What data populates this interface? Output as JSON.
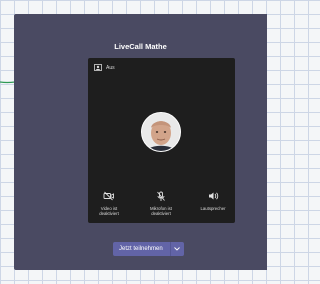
{
  "meeting": {
    "title": "LiveCall Mathe"
  },
  "preview": {
    "background_label": "Aus"
  },
  "controls": {
    "video": {
      "line1": "Video ist",
      "line2": "deaktiviert",
      "icon": "video-off-icon"
    },
    "mic": {
      "line1": "Mikrofon ist",
      "line2": "deaktiviert",
      "icon": "mic-off-icon"
    },
    "speaker": {
      "line1": "Lautsprecher",
      "icon": "speaker-icon"
    }
  },
  "join": {
    "label": "Jetzt teilnehmen",
    "icon": "chevron-down-icon"
  },
  "colors": {
    "panel": "#4a4a62",
    "preview": "#1e1e1e",
    "accent": "#6264a7",
    "scribble": "#2f9a55"
  }
}
